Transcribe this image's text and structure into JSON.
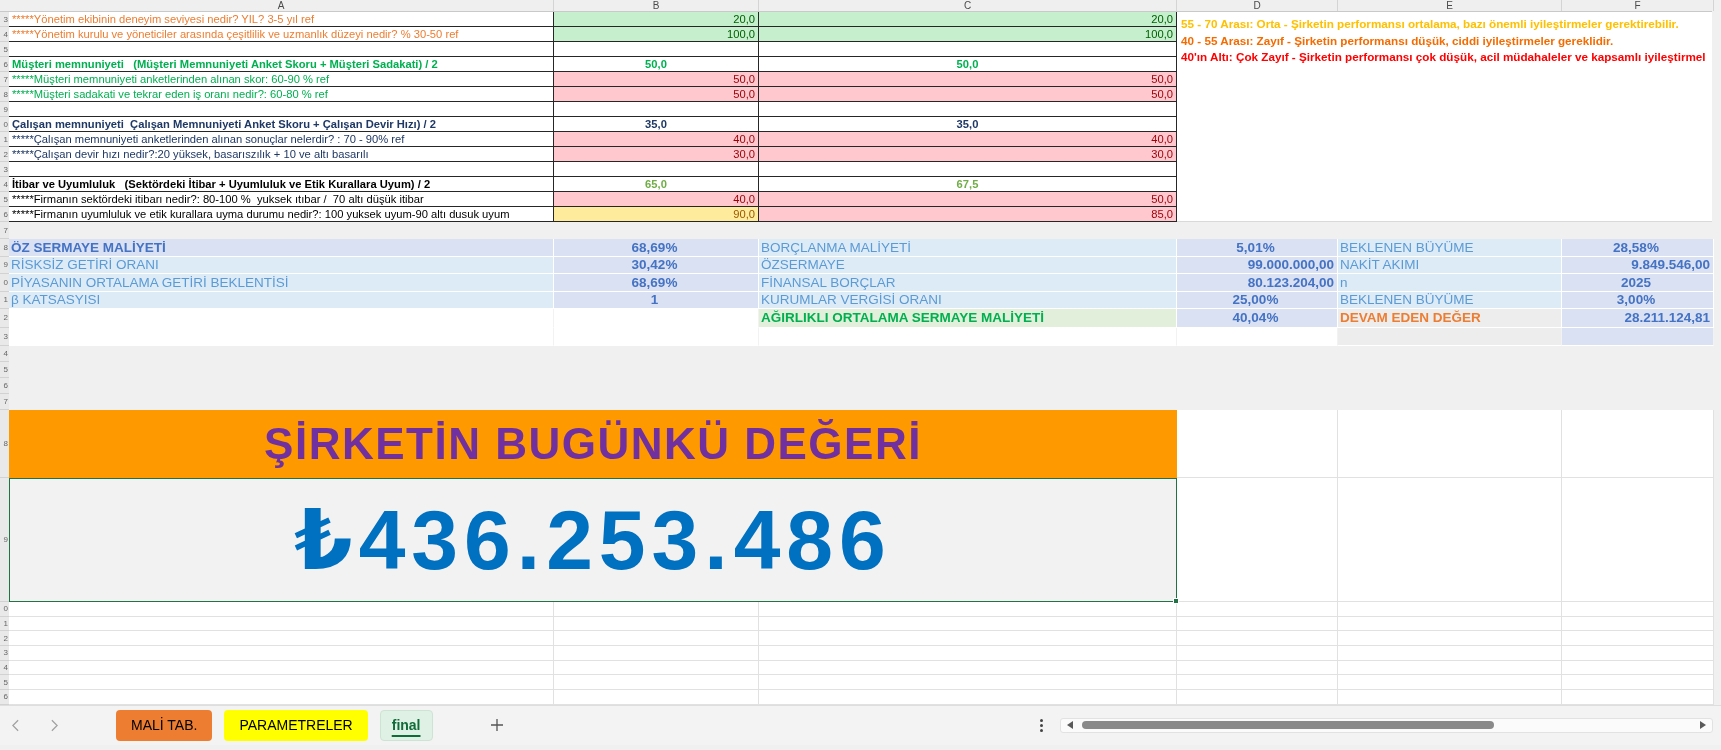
{
  "columns": [
    "A",
    "B",
    "C",
    "D",
    "E",
    "F"
  ],
  "row_headers": [
    "3",
    "4",
    "5",
    "6",
    "7",
    "8",
    "9",
    "0",
    "1",
    "2",
    "3",
    "4",
    "5",
    "6",
    "7",
    "8",
    "9",
    "0",
    "1",
    "2",
    "3",
    "4",
    "5",
    "6",
    "7",
    "8",
    "9",
    "0",
    "1",
    "2",
    "3",
    "4",
    "5",
    "6"
  ],
  "scorecard": {
    "rows": [
      {
        "kind": "question",
        "label": "*****Yönetim ekibinin deneyim seviyesi nedir? YIL? 3-5 yıl ref",
        "color": "#ed7d31",
        "b": {
          "text": "20,0",
          "kind": "good"
        },
        "c": {
          "text": "20,0",
          "kind": "good"
        }
      },
      {
        "kind": "question",
        "label": "*****Yönetim kurulu ve yöneticiler arasında çeşitlilik ve uzmanlık düzeyi nedir? % 30-50 ref",
        "color": "#ed7d31",
        "b": {
          "text": "100,0",
          "kind": "good"
        },
        "c": {
          "text": "100,0",
          "kind": "good"
        }
      },
      {
        "kind": "blank"
      },
      {
        "kind": "heading",
        "label": "Müşteri memnuniyeti   (Müşteri Memnuniyeti Anket Skoru + Müşteri Sadakati) / 2",
        "color": "#00b050",
        "b": {
          "text": "50,0",
          "color": "#00b050"
        },
        "c": {
          "text": "50,0",
          "color": "#00b050"
        }
      },
      {
        "kind": "question",
        "label": "*****Müşteri memnuniyeti anketlerinden alınan skor: 60-90 % ref",
        "color": "#00b050",
        "b": {
          "text": "50,0",
          "kind": "bad"
        },
        "c": {
          "text": "50,0",
          "kind": "bad"
        }
      },
      {
        "kind": "question",
        "label": "*****Müşteri sadakati ve tekrar eden iş oranı nedir?: 60-80 % ref",
        "color": "#00b050",
        "b": {
          "text": "50,0",
          "kind": "bad"
        },
        "c": {
          "text": "50,0",
          "kind": "bad"
        }
      },
      {
        "kind": "blank"
      },
      {
        "kind": "heading",
        "label": "Çalışan memnuniyeti  Çalışan Memnuniyeti Anket Skoru + Çalışan Devir Hızı) / 2",
        "color": "#1f3864",
        "b": {
          "text": "35,0",
          "color": "#1f3864"
        },
        "c": {
          "text": "35,0",
          "color": "#1f3864"
        }
      },
      {
        "kind": "question",
        "label": "*****Çalışan memnuniyeti anketlerinden alınan sonuçlar nelerdir? : 70 - 90% ref",
        "color": "#1f3864",
        "b": {
          "text": "40,0",
          "kind": "bad"
        },
        "c": {
          "text": "40,0",
          "kind": "bad"
        }
      },
      {
        "kind": "question",
        "label": "*****Çalışan devir hızı nedir?:20 yüksek, basarıszılık + 10 ve altı basarılı",
        "color": "#1f3864",
        "b": {
          "text": "30,0",
          "kind": "bad"
        },
        "c": {
          "text": "30,0",
          "kind": "bad"
        }
      },
      {
        "kind": "blank"
      },
      {
        "kind": "heading",
        "label": "İtibar ve Uyumluluk   (Sektördeki İtibar + Uyumluluk ve Etik Kurallara Uyum) / 2",
        "color": "#000000",
        "b": {
          "text": "65,0",
          "color": "#70ad47"
        },
        "c": {
          "text": "67,5",
          "color": "#70ad47"
        }
      },
      {
        "kind": "question",
        "label": "*****Firmanın sektördeki itibarı nedir?: 80-100 %  yuksek ıtıbar /  70 altı düşük itibar",
        "color": "#000000",
        "b": {
          "text": "40,0",
          "kind": "bad"
        },
        "c": {
          "text": "50,0",
          "kind": "bad"
        }
      },
      {
        "kind": "question",
        "label": "*****Firmanın uyumluluk ve etik kurallara uyma durumu nedir?: 100 yuksek uyum-90 altı dusuk uyum",
        "color": "#000000",
        "b": {
          "text": "90,0",
          "kind": "neutral"
        },
        "c": {
          "text": "85,0",
          "kind": "bad"
        }
      }
    ]
  },
  "notes": [
    {
      "text": "55 - 70 Arası: Orta - Şirketin performansı ortalama, bazı önemli iyileştirmeler gerektirebilir.",
      "color": "#ffc000"
    },
    {
      "text": "40 - 55 Arası: Zayıf - Şirketin performansı düşük, ciddi iyileştirmeler gereklidir.",
      "color": "#f46b00"
    },
    {
      "text": "40'ın Altı: Çok Zayıf - Şirketin performansı çok düşük, acil müdahaleler ve kapsamlı iyileştirmel",
      "color": "#ff0000"
    }
  ],
  "valuation": {
    "groups": [
      {
        "rows": [
          {
            "label": "ÖZ SERMAYE MALİYETİ",
            "kind": "title",
            "color": "#4472c4",
            "value": {
              "text": "68,69%",
              "kind": "percent"
            }
          },
          {
            "label": "RİSKSİZ GETİRİ ORANI",
            "kind": "input",
            "value": {
              "text": "30,42%",
              "kind": "percent"
            }
          },
          {
            "label": "PİYASANIN ORTALAMA GETİRİ BEKLENTİSİ",
            "kind": "input",
            "value": {
              "text": "68,69%",
              "kind": "percent"
            }
          },
          {
            "label": "β KATSASYISI",
            "kind": "input",
            "value": {
              "text": "1",
              "kind": "number"
            }
          }
        ]
      },
      {
        "rows": [
          {
            "label": "BORÇLANMA MALİYETİ",
            "kind": "input",
            "value": {
              "text": "5,01%",
              "kind": "percent"
            }
          },
          {
            "label": "ÖZSERMAYE",
            "kind": "input",
            "value": {
              "text": "99.000.000,00",
              "kind": "amount"
            }
          },
          {
            "label": "FİNANSAL BORÇLAR",
            "kind": "input",
            "value": {
              "text": "80.123.204,00",
              "kind": "amount"
            }
          },
          {
            "label": "KURUMLAR VERGİSİ ORANI",
            "kind": "input",
            "value": {
              "text": "25,00%",
              "kind": "percent"
            }
          },
          {
            "label": "AĞIRLIKLI ORTALAMA SERMAYE MALİYETİ",
            "kind": "total",
            "color": "#00b050",
            "value": {
              "text": "40,04%",
              "kind": "percent"
            }
          }
        ]
      },
      {
        "rows": [
          {
            "label": "BEKLENEN BÜYÜME",
            "kind": "input",
            "value": {
              "text": "28,58%",
              "kind": "percent"
            }
          },
          {
            "label": "NAKİT AKIMI",
            "kind": "input",
            "value": {
              "text": "9.849.546,00",
              "kind": "amount"
            }
          },
          {
            "label": "n",
            "kind": "input",
            "value": {
              "text": "2025",
              "kind": "number"
            }
          },
          {
            "label": "BEKLENEN BÜYÜME",
            "kind": "input",
            "value": {
              "text": "3,00%",
              "kind": "percent"
            }
          },
          {
            "label": "DEVAM EDEN DEĞER",
            "kind": "result",
            "color": "#ed7d31",
            "value": {
              "text": "28.211.124,81",
              "kind": "amount"
            }
          }
        ]
      }
    ]
  },
  "present_value": {
    "title": "ŞİRKETİN BUGÜNKÜ DEĞERİ",
    "value": "₺436.253.486",
    "selected": true
  },
  "sheet_tabs": [
    {
      "label": "MALİ TAB.",
      "color": "#ed7d31",
      "selected": false
    },
    {
      "label": "PARAMETRELER",
      "color": "#ffff00",
      "selected": false
    },
    {
      "label": "final",
      "selected": true
    }
  ]
}
